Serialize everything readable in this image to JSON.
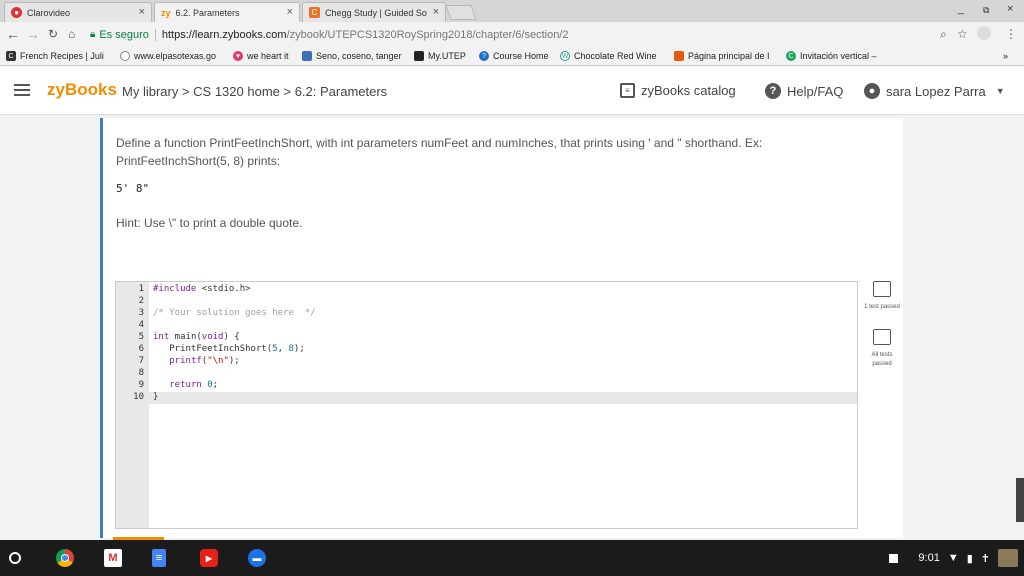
{
  "browser": {
    "tabs": [
      {
        "label": "Clarovideo"
      },
      {
        "label": "6.2. Parameters"
      },
      {
        "label": "Chegg Study | Guided So"
      }
    ],
    "secure_label": "Es seguro",
    "url_host": "https://learn.zybooks.com",
    "url_path": "/zybook/UTEPCS1320RoySpring2018/chapter/6/section/2",
    "bookmarks": [
      {
        "label": "French Recipes | Juli"
      },
      {
        "label": "www.elpasotexas.go"
      },
      {
        "label": "we heart it"
      },
      {
        "label": "Seno, coseno, tanger"
      },
      {
        "label": "My.UTEP"
      },
      {
        "label": "Course Home"
      },
      {
        "label": "Chocolate Red Wine"
      },
      {
        "label": "Página principal de I"
      },
      {
        "label": "Invitación vertical –"
      }
    ],
    "more_bookmarks": "»"
  },
  "header": {
    "logo": "zyBooks",
    "breadcrumb": "My library > CS 1320 home > 6.2: Parameters",
    "catalog": "zyBooks catalog",
    "help": "Help/FAQ",
    "user": "sara Lopez Parra"
  },
  "exercise": {
    "prompt": "Define a function PrintFeetInchShort, with int parameters numFeet and numInches, that prints using ' and \" shorthand. Ex: PrintFeetInchShort(5, 8) prints:",
    "example_output": "5' 8\"",
    "hint": "Hint: Use \\\" to print a double quote.",
    "line_numbers": [
      "1",
      "2",
      "3",
      "4",
      "5",
      "6",
      "7",
      "8",
      "9",
      "10"
    ],
    "result1": "1 test passed",
    "result2": "All tests passed"
  },
  "shelf": {
    "time": "9:01"
  }
}
